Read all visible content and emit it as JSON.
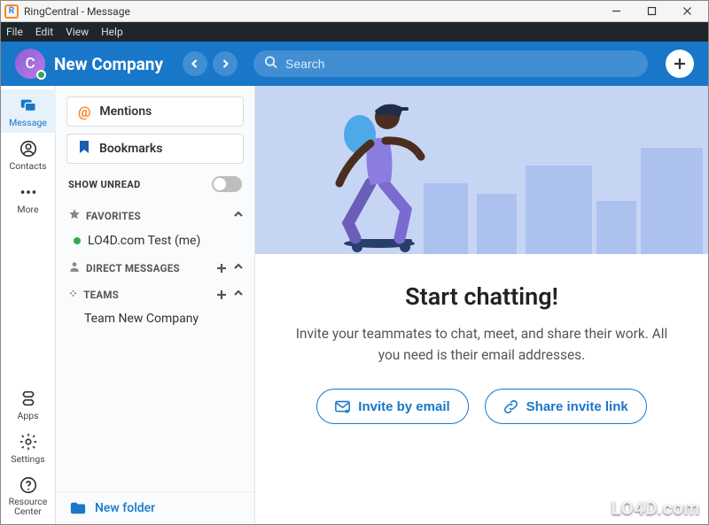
{
  "window": {
    "title": "RingCentral - Message",
    "app_icon_letter": "R"
  },
  "menubar": [
    "File",
    "Edit",
    "View",
    "Help"
  ],
  "header": {
    "avatar_letter": "C",
    "company_name": "New Company",
    "search_placeholder": "Search"
  },
  "rail": {
    "top": [
      {
        "key": "message",
        "label": "Message",
        "active": true
      },
      {
        "key": "contacts",
        "label": "Contacts",
        "active": false
      },
      {
        "key": "more",
        "label": "More",
        "active": false
      }
    ],
    "bottom": [
      {
        "key": "apps",
        "label": "Apps"
      },
      {
        "key": "settings",
        "label": "Settings"
      },
      {
        "key": "resource_center",
        "label": "Resource Center"
      }
    ]
  },
  "sidebar": {
    "mentions_label": "Mentions",
    "bookmarks_label": "Bookmarks",
    "show_unread_label": "SHOW UNREAD",
    "show_unread_on": false,
    "sections": {
      "favorites": {
        "label": "FAVORITES",
        "items": [
          {
            "label": "LO4D.com Test (me)",
            "presence": "online"
          }
        ]
      },
      "direct_messages": {
        "label": "DIRECT MESSAGES",
        "items": []
      },
      "teams": {
        "label": "TEAMS",
        "items": [
          {
            "label": "Team New Company"
          }
        ]
      }
    },
    "new_folder_label": "New folder"
  },
  "main": {
    "heading": "Start chatting!",
    "subtext": "Invite your teammates to chat, meet, and share their work. All you need is their email addresses.",
    "invite_email_label": "Invite by email",
    "share_link_label": "Share invite link"
  },
  "watermark": "LO4D.com"
}
